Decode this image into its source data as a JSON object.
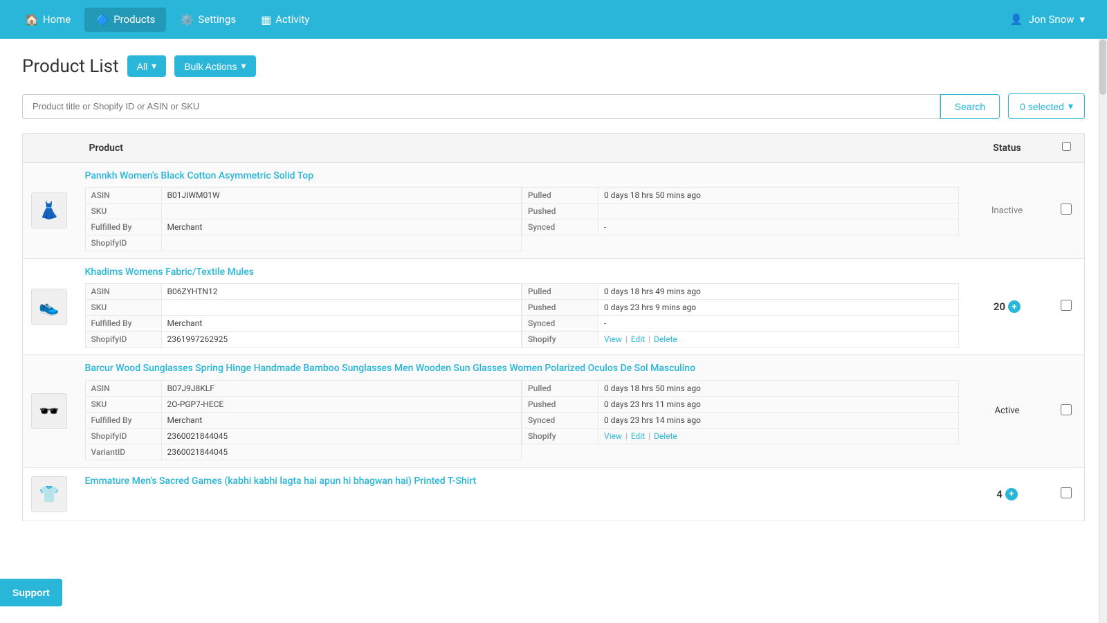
{
  "nav": {
    "items": [
      {
        "id": "home",
        "label": "Home",
        "icon": "🏠",
        "active": false
      },
      {
        "id": "products",
        "label": "Products",
        "icon": "🔷",
        "active": true
      },
      {
        "id": "settings",
        "label": "Settings",
        "icon": "⚙️",
        "active": false
      },
      {
        "id": "activity",
        "label": "Activity",
        "icon": "▦",
        "active": false
      }
    ],
    "user": {
      "name": "Jon Snow",
      "icon": "👤"
    }
  },
  "page": {
    "title": "Product List",
    "all_btn": "All",
    "bulk_btn": "Bulk Actions",
    "search_placeholder": "Product title or Shopify ID or ASIN or SKU",
    "search_btn": "Search",
    "selected_btn": "0 selected",
    "table_headers": {
      "product": "Product",
      "status": "Status"
    }
  },
  "products": [
    {
      "id": 1,
      "name": "Pannkh Women's Black Cotton Asymmetric Solid Top",
      "img_emoji": "👗",
      "status": "Inactive",
      "status_type": "inactive",
      "meta_left": [
        {
          "label": "ASIN",
          "value": "B01JIWM01W"
        },
        {
          "label": "SKU",
          "value": ""
        },
        {
          "label": "Fulfilled By",
          "value": "Merchant"
        },
        {
          "label": "ShopifyID",
          "value": ""
        }
      ],
      "meta_right": [
        {
          "label": "Pulled",
          "value": "0 days 18 hrs 50 mins ago",
          "is_link": false
        },
        {
          "label": "Pushed",
          "value": "",
          "is_link": false
        },
        {
          "label": "Synced",
          "value": "-",
          "is_link": false
        }
      ]
    },
    {
      "id": 2,
      "name": "Khadims Womens Fabric/Textile Mules",
      "img_emoji": "👟",
      "status": "20",
      "status_type": "count",
      "meta_left": [
        {
          "label": "ASIN",
          "value": "B06ZYHTN12"
        },
        {
          "label": "SKU",
          "value": ""
        },
        {
          "label": "Fulfilled By",
          "value": "Merchant"
        },
        {
          "label": "ShopifyID",
          "value": "2361997262925"
        }
      ],
      "meta_right": [
        {
          "label": "Pulled",
          "value": "0 days 18 hrs 49 mins ago",
          "is_link": false
        },
        {
          "label": "Pushed",
          "value": "0 days 23 hrs 9 mins ago",
          "is_link": false
        },
        {
          "label": "Synced",
          "value": "-",
          "is_link": false
        },
        {
          "label": "Shopify",
          "value": "View | Edit | Delete",
          "is_link": true
        }
      ]
    },
    {
      "id": 3,
      "name": "Barcur Wood Sunglasses Spring Hinge Handmade Bamboo Sunglasses Men Wooden Sun Glasses Women Polarized Oculos De Sol Masculino",
      "img_emoji": "🕶️",
      "status": "Active",
      "status_type": "active",
      "meta_left": [
        {
          "label": "ASIN",
          "value": "B07J9J8KLF"
        },
        {
          "label": "SKU",
          "value": "2O-PGP7-HECE"
        },
        {
          "label": "Fulfilled By",
          "value": "Merchant"
        },
        {
          "label": "ShopifyID",
          "value": "2360021844045"
        },
        {
          "label": "VariantID",
          "value": "2360021844045"
        }
      ],
      "meta_right": [
        {
          "label": "Pulled",
          "value": "0 days 18 hrs 50 mins ago",
          "is_link": false
        },
        {
          "label": "Pushed",
          "value": "0 days 23 hrs 11 mins ago",
          "is_link": false
        },
        {
          "label": "Synced",
          "value": "0 days 23 hrs 14 mins ago",
          "is_link": false
        },
        {
          "label": "Shopify",
          "value": "View | Edit | Delete",
          "is_link": true
        }
      ]
    },
    {
      "id": 4,
      "name": "Emmature Men's Sacred Games (kabhi kabhi lagta hai apun hi bhagwan hai) Printed T-Shirt",
      "img_emoji": "👕",
      "status": "4",
      "status_type": "count",
      "meta_left": [],
      "meta_right": []
    }
  ],
  "support": {
    "label": "Support"
  }
}
